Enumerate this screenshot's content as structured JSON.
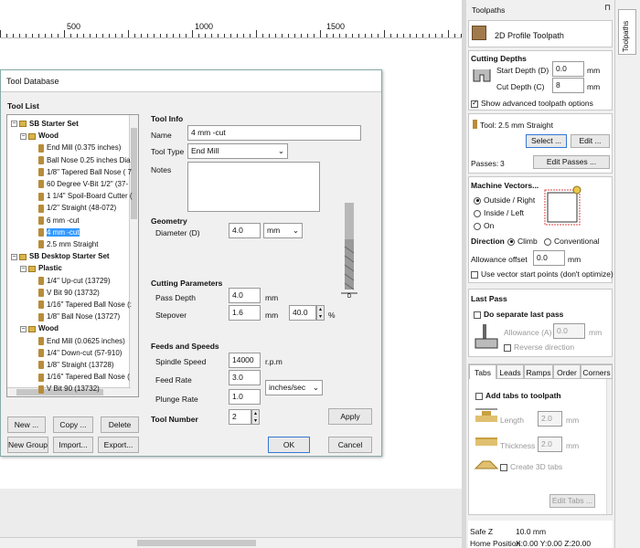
{
  "ruler": {
    "labels": [
      "500",
      "1000",
      "1500"
    ]
  },
  "dialog": {
    "title": "Tool Database",
    "tool_list_label": "Tool List",
    "tree": [
      {
        "text": "SB Starter Set",
        "kind": "group",
        "pm": "−",
        "bold": true
      },
      {
        "text": "Wood",
        "kind": "folder",
        "pm": "−",
        "bold": true
      },
      {
        "text": "End Mill (0.375 inches)",
        "kind": "tool"
      },
      {
        "text": "Ball Nose 0.25 inches Dia",
        "kind": "tool"
      },
      {
        "text": "1/8\" Tapered Ball Nose ( 7",
        "kind": "tool"
      },
      {
        "text": "60 Degree V-Bit 1/2\" (37-",
        "kind": "tool"
      },
      {
        "text": "1 1/4\" Spoil-Board Cutter (",
        "kind": "tool"
      },
      {
        "text": "1/2\" Straight (48-072)",
        "kind": "tool"
      },
      {
        "text": "6 mm -cut",
        "kind": "tool"
      },
      {
        "text": "4 mm -cut",
        "kind": "tool",
        "selected": true
      },
      {
        "text": "2.5 mm Straight",
        "kind": "tool"
      },
      {
        "text": "SB Desktop Starter Set",
        "kind": "group",
        "pm": "−",
        "bold": true
      },
      {
        "text": "Plastic",
        "kind": "folder",
        "pm": "−",
        "bold": true
      },
      {
        "text": "1/4\" Up-cut (13729)",
        "kind": "tool"
      },
      {
        "text": "V Bit 90 (13732)",
        "kind": "tool"
      },
      {
        "text": "1/16\" Tapered Ball Nose (:",
        "kind": "tool"
      },
      {
        "text": "1/8\" Ball Nose (13727)",
        "kind": "tool"
      },
      {
        "text": "Wood",
        "kind": "folder",
        "pm": "−",
        "bold": true
      },
      {
        "text": "End Mill (0.0625 inches)",
        "kind": "tool"
      },
      {
        "text": "1/4\" Down-cut (57-910)",
        "kind": "tool"
      },
      {
        "text": "1/8\" Straight (13728)",
        "kind": "tool"
      },
      {
        "text": "1/16\" Tapered Ball Nose (",
        "kind": "tool"
      },
      {
        "text": "V Bit 90 (13732)",
        "kind": "tool"
      },
      {
        "text": "1/8\" Ball Nose (13727)",
        "kind": "tool"
      }
    ],
    "buttons": {
      "new": "New ...",
      "copy": "Copy ...",
      "delete": "Delete",
      "new_group": "New Group",
      "import": "Import...",
      "export": "Export...",
      "apply": "Apply",
      "ok": "OK",
      "cancel": "Cancel"
    },
    "info": {
      "header": "Tool Info",
      "name_label": "Name",
      "name_value": "4 mm -cut",
      "type_label": "Tool Type",
      "type_value": "End Mill",
      "notes_label": "Notes"
    },
    "geometry": {
      "header": "Geometry",
      "diameter_label": "Diameter (D)",
      "diameter_value": "4.0",
      "diameter_unit": "mm"
    },
    "cutting": {
      "header": "Cutting Parameters",
      "pass_label": "Pass Depth",
      "pass_value": "4.0",
      "pass_unit": "mm",
      "stepover_label": "Stepover",
      "stepover_value": "1.6",
      "stepover_unit": "mm",
      "stepover_pct": "40.0",
      "pct": "%"
    },
    "feeds": {
      "header": "Feeds and Speeds",
      "spindle_label": "Spindle Speed",
      "spindle_value": "14000",
      "spindle_unit": "r.p.m",
      "feed_label": "Feed Rate",
      "feed_value": "3.0",
      "plunge_label": "Plunge Rate",
      "plunge_value": "1.0",
      "rate_unit": "inches/sec"
    },
    "tool_number": {
      "label": "Tool Number",
      "value": "2"
    }
  },
  "panel": {
    "header": "Toolpaths",
    "side_tab": "Toolpaths",
    "title": "2D Profile Toolpath",
    "cutting_depths": "Cutting Depths",
    "start_label": "Start Depth (D)",
    "start_value": "0.0",
    "start_unit": "mm",
    "cut_label": "Cut Depth (C)",
    "cut_value": "8",
    "cut_unit": "mm",
    "show_adv": "Show advanced toolpath options",
    "tool_label": "Tool:",
    "tool_value": "2.5 mm Straight",
    "select": "Select ...",
    "edit": "Edit ...",
    "passes_label": "Passes:",
    "passes_value": "3",
    "edit_passes": "Edit Passes ...",
    "machine_vectors": "Machine Vectors...",
    "outside": "Outside / Right",
    "inside": "Inside / Left",
    "on": "On",
    "direction": "Direction",
    "climb": "Climb",
    "conventional": "Conventional",
    "allowance": "Allowance offset",
    "allowance_value": "0.0",
    "allowance_unit": "mm",
    "vector_start": "Use vector start points (don't optimize)",
    "last_pass": "Last Pass",
    "separate": "Do separate last pass",
    "allowance_a": "Allowance (A)",
    "allowance_a_value": "0.0",
    "allowance_a_unit": "mm",
    "reverse": "Reverse direction",
    "tabs": [
      "Tabs",
      "Leads",
      "Ramps",
      "Order",
      "Corners"
    ],
    "add_tabs": "Add tabs to toolpath",
    "length": "Length",
    "length_value": "2.0",
    "length_unit": "mm",
    "thickness": "Thickness",
    "thickness_value": "2.0",
    "thickness_unit": "mm",
    "create3d": "Create 3D tabs",
    "edit_tabs": "Edit Tabs ...",
    "safe_z": "Safe Z",
    "safe_z_value": "10.0 mm",
    "home": "Home Position",
    "home_value": "X:0.00 Y:0.00 Z:20.00"
  }
}
